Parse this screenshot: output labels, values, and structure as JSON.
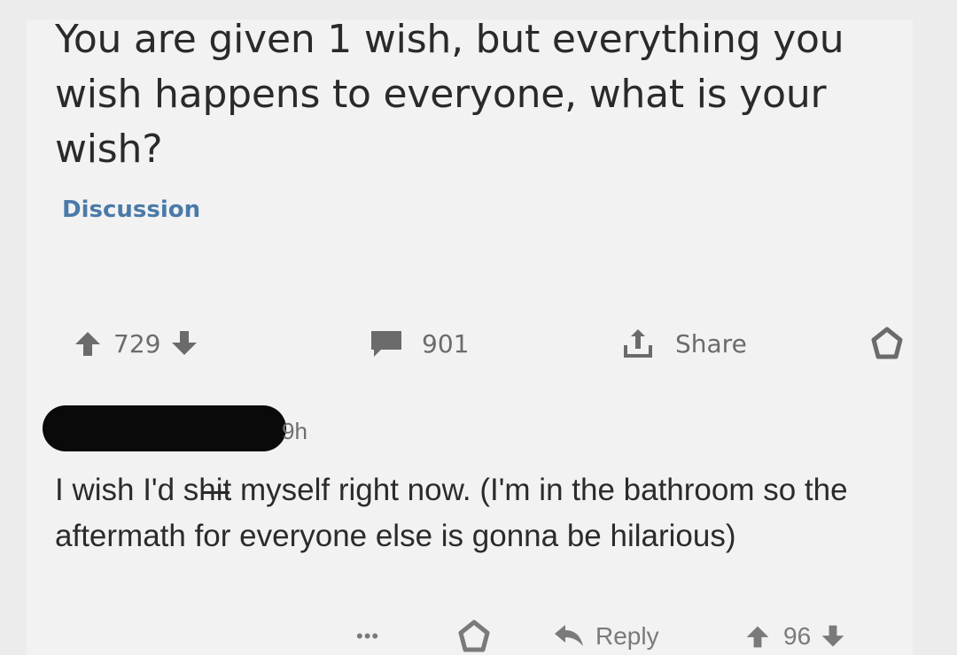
{
  "post": {
    "title": "You are given 1 wish, but everything you wish happens to everyone, what is your wish?",
    "flair": "Discussion",
    "score": "729",
    "comment_count": "901",
    "share_label": "Share"
  },
  "comment": {
    "timestamp": "9h",
    "text_before": "I wish I'd s",
    "text_struck": "hit",
    "text_after": " myself right now. (I'm in the bathroom so the aftermath for everyone else is gonna be hilarious)",
    "more_label": "•••",
    "reply_label": "Reply",
    "score": "96"
  },
  "colors": {
    "background": "#f2f2f2",
    "text": "#2a2a2a",
    "flair": "#4a7aa8",
    "icon": "#6b6b6b",
    "redaction": "#0a0a0a"
  },
  "icons": [
    "upvote-icon",
    "downvote-icon",
    "comment-icon",
    "share-icon",
    "save-icon",
    "more-icon",
    "reply-icon"
  ]
}
